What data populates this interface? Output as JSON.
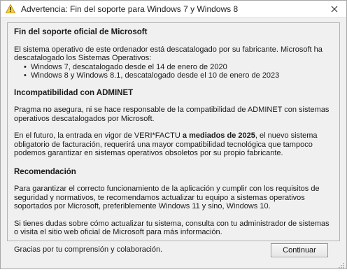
{
  "window": {
    "title": "Advertencia: Fin del soporte para Windows 7 y Windows 8",
    "title_icon": "warning-icon",
    "close_icon": "close-icon"
  },
  "content": {
    "section1": {
      "heading": "Fin del soporte oficial de Microsoft",
      "paragraph": "El sistema operativo de este ordenador está descatalogado por su fabricante. Microsoft ha descatalogado los Sistemas Operativos:",
      "items": [
        "Windows 7, descatalogado desde el 14 de enero de 2020",
        "Windows 8 y Windows 8.1, descatalogado desde el 10 de enero de 2023"
      ]
    },
    "section2": {
      "heading": "Incompatibilidad con ADMINET",
      "paragraph1": "Pragma no asegura, ni se hace responsable de la compatibilidad de ADMINET con sistemas operativos descatalogados por Microsoft.",
      "paragraph2_pre": "En el futuro, la entrada en vigor de VERI*FACTU ",
      "paragraph2_bold": "a mediados de 2025",
      "paragraph2_post": ", el nuevo sistema obligatorio de facturación, requerirá una mayor compatibilidad tecnológica que tampoco podemos garantizar en sistemas operativos obsoletos por su propio fabricante."
    },
    "section3": {
      "heading": "Recomendación",
      "paragraph1": "Para garantizar el correcto funcionamiento de la aplicación y cumplir con los requisitos de seguridad y normativos, te recomendamos actualizar tu equipo a sistemas operativos soportados por Microsoft, preferiblemente Windows 11 y sino, Windows 10.",
      "paragraph2": "Si tienes dudas sobre cómo actualizar tu sistema, consulta con tu administrador de sistemas o visita el sitio web oficial de Microsoft para más información.",
      "paragraph3": "Gracias por tu comprensión y colaboración."
    }
  },
  "buttons": {
    "continue_label": "Continuar"
  }
}
